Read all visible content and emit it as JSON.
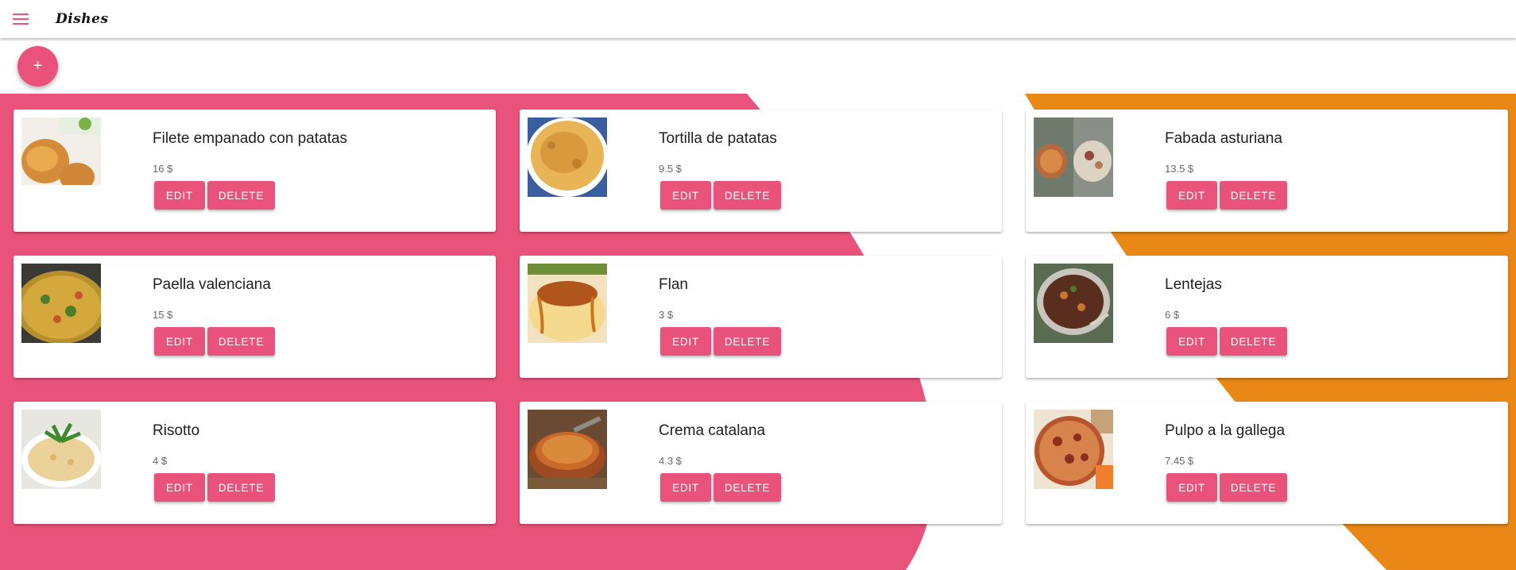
{
  "app": {
    "title": "Dishes"
  },
  "colors": {
    "accent": "#e9527a",
    "orange": "#e98717"
  },
  "toolbar": {
    "menu_icon": "hamburger-menu-icon"
  },
  "fab": {
    "label": "+"
  },
  "actions": {
    "edit_label": "EDIT",
    "delete_label": "DELETE"
  },
  "dishes": [
    {
      "name": "Filete empanado con patatas",
      "price": "16 $",
      "image": "breaded-cutlet"
    },
    {
      "name": "Tortilla de patatas",
      "price": "9.5 $",
      "image": "spanish-omelette"
    },
    {
      "name": "Fabada asturiana",
      "price": "13.5 $",
      "image": "bean-stew"
    },
    {
      "name": "Paella valenciana",
      "price": "15 $",
      "image": "paella"
    },
    {
      "name": "Flan",
      "price": "3 $",
      "image": "flan"
    },
    {
      "name": "Lentejas",
      "price": "6 $",
      "image": "lentils"
    },
    {
      "name": "Risotto",
      "price": "4 $",
      "image": "risotto"
    },
    {
      "name": "Crema catalana",
      "price": "4.3 $",
      "image": "crema-catalana"
    },
    {
      "name": "Pulpo a la gallega",
      "price": "7.45 $",
      "image": "octopus"
    }
  ]
}
